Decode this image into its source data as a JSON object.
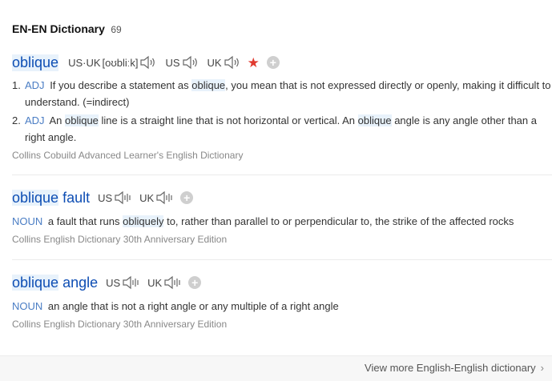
{
  "header": {
    "title": "EN-EN Dictionary",
    "count": "69"
  },
  "entries": [
    {
      "headword": "oblique",
      "us_uk_label": "US·UK",
      "phonetic": "[oʊbliːk]",
      "us_label": "US",
      "uk_label": "UK",
      "definitions": [
        {
          "num": "1.",
          "pos": "ADJ",
          "before": "If you describe a statement as ",
          "term": "oblique",
          "after": ", you mean that is not expressed directly or openly, making it difficult to understand. (=indirect)"
        },
        {
          "num": "2.",
          "pos": "ADJ",
          "before": "An ",
          "term": "oblique",
          "middle": " line is a straight line that is not horizontal or vertical. An ",
          "term2": "oblique",
          "after": " angle is any angle other than a right angle."
        }
      ],
      "source": "Collins Cobuild Advanced Learner's English Dictionary"
    },
    {
      "headword_main": "oblique",
      "headword_rest": " fault",
      "us_label": "US",
      "uk_label": "UK",
      "pos": "NOUN",
      "before": "a fault that runs ",
      "term": "obliquely",
      "after": " to, rather than parallel to or perpendicular to, the strike of the affected rocks",
      "source": "Collins English Dictionary 30th Anniversary Edition"
    },
    {
      "headword_main": "oblique",
      "headword_rest": " angle",
      "us_label": "US",
      "uk_label": "UK",
      "pos": "NOUN",
      "text": "an angle that is not a right angle or any multiple of a right angle",
      "source": "Collins English Dictionary 30th Anniversary Edition"
    }
  ],
  "footer": {
    "more_label": "View more English-English dictionary"
  },
  "colors": {
    "headword": "#0e4eb4",
    "pos": "#4a7dc4",
    "star": "#e03a2f",
    "highlight": "#e8f2fb"
  },
  "icons": {
    "speaker": "speaker-icon",
    "star": "star-icon",
    "add": "plus-icon",
    "chevron": "chevron-right-icon"
  }
}
